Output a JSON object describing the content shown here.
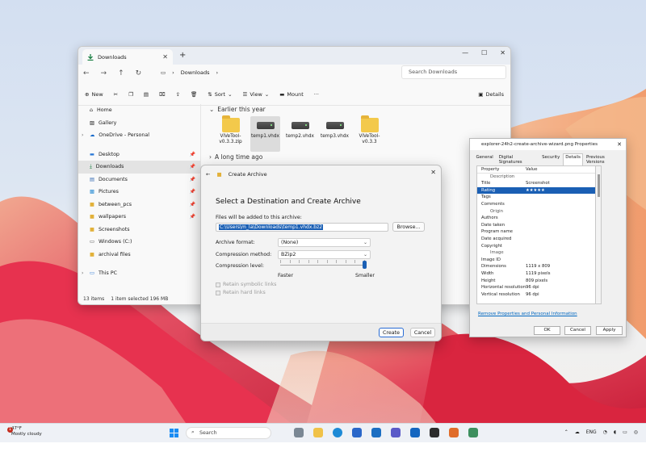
{
  "explorer": {
    "tab_title": "Downloads",
    "path": "Downloads",
    "search_placeholder": "Search Downloads",
    "toolbar": {
      "new": "New",
      "sort": "Sort",
      "view": "View",
      "mount": "Mount",
      "more": "···",
      "details": "Details"
    },
    "sidebar": {
      "home": "Home",
      "gallery": "Gallery",
      "onedrive": "OneDrive - Personal",
      "quick": [
        "Desktop",
        "Downloads",
        "Documents",
        "Pictures",
        "between_pcs",
        "wallpapers",
        "Screenshots",
        "Windows (C:)",
        "archival files"
      ],
      "thispc": "This PC"
    },
    "groups": {
      "recent": "Earlier this year",
      "older": "A long time ago"
    },
    "files": [
      {
        "name": "ViVeTool-v0.3.3.zip",
        "type": "folder"
      },
      {
        "name": "temp1.vhdx",
        "type": "drive"
      },
      {
        "name": "temp2.vhdx",
        "type": "drive"
      },
      {
        "name": "temp3.vhdx",
        "type": "drive"
      },
      {
        "name": "ViVeTool-v0.3.3",
        "type": "folder"
      }
    ],
    "status": {
      "items": "13 items",
      "selection": "1 item selected  196 MB"
    }
  },
  "archive": {
    "header": "Create Archive",
    "title": "Select a Destination and Create Archive",
    "files_label": "Files will be added to this archive:",
    "path_value": "C:\\Users\\m_la\\Downloads\\temp1.vhdx.bz2",
    "browse": "Browse...",
    "format_label": "Archive format:",
    "format_value": "(None)",
    "method_label": "Compression method:",
    "method_value": "BZip2",
    "level_label": "Compression level:",
    "level_min": "Faster",
    "level_max": "Smaller",
    "level_fraction": 1.0,
    "symlinks": "Retain symbolic links",
    "hardlinks": "Retain hard links",
    "create": "Create",
    "cancel": "Cancel"
  },
  "props": {
    "title": "explorer-24h2-create-archive-wizard.png Properties",
    "tabs": [
      "General",
      "Digital Signatures",
      "Security",
      "Details",
      "Previous Versions"
    ],
    "col_property": "Property",
    "col_value": "Value",
    "sections": {
      "description": "Description",
      "origin": "Origin",
      "image": "Image"
    },
    "description_rows": [
      {
        "k": "Title",
        "v": "Screenshot"
      },
      {
        "k": "Rating",
        "v": "★★★★★"
      },
      {
        "k": "Tags",
        "v": ""
      },
      {
        "k": "Comments",
        "v": ""
      }
    ],
    "origin_rows": [
      {
        "k": "Authors",
        "v": ""
      },
      {
        "k": "Date taken",
        "v": ""
      },
      {
        "k": "Program name",
        "v": ""
      },
      {
        "k": "Date acquired",
        "v": ""
      },
      {
        "k": "Copyright",
        "v": ""
      }
    ],
    "image_rows": [
      {
        "k": "Image ID",
        "v": ""
      },
      {
        "k": "Dimensions",
        "v": "1119 x 809"
      },
      {
        "k": "Width",
        "v": "1119 pixels"
      },
      {
        "k": "Height",
        "v": "809 pixels"
      },
      {
        "k": "Horizontal resolution",
        "v": "96 dpi"
      },
      {
        "k": "Vertical resolution",
        "v": "96 dpi"
      }
    ],
    "link": "Remove Properties and Personal Information",
    "ok": "OK",
    "cancel": "Cancel",
    "apply": "Apply"
  },
  "taskbar": {
    "weather_temp": "47°F",
    "weather_desc": "Mostly cloudy",
    "weather_badge": "1",
    "search": "Search",
    "lang": "ENG"
  },
  "colors": {
    "accent": "#1a5fb4",
    "folder": "#f3c94b"
  }
}
